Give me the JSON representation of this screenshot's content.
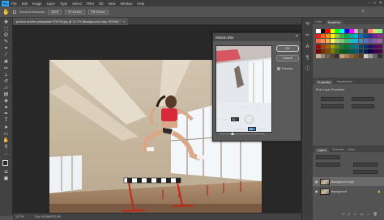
{
  "menubar": {
    "logo": "Ps",
    "items": [
      "File",
      "Edit",
      "Image",
      "Layer",
      "Type",
      "Select",
      "Filter",
      "3D",
      "View",
      "Window",
      "Help"
    ]
  },
  "options_bar": {
    "scroll_all_windows": "Scroll All Windows",
    "zoom_value": "100%",
    "fit_screen": "Fit Screen",
    "fill_screen": "Fill Screen"
  },
  "document_tab": {
    "title": "powers andres pierquidde 578734.jpg @ 12.7% (Background copy, RGB/8) *",
    "close": "×"
  },
  "status_bar": {
    "zoom": "12.7%",
    "doc_info": "Doc: 62.6M/125.2M"
  },
  "dialog": {
    "title": "Motion Blur",
    "ok_label": "OK",
    "cancel_label": "Cancel",
    "preview_label": "Preview",
    "preview_checked": true,
    "zoom_percent": "100%",
    "angle_label": "Angle:",
    "angle_value": "11",
    "angle_unit": "°",
    "distance_label": "Distance:",
    "distance_value": "45",
    "distance_unit": "Pixels"
  },
  "swatches_panel": {
    "tabs": [
      "Color",
      "Swatches"
    ],
    "active_tab": "Swatches",
    "colors": [
      "#ffffff",
      "#000000",
      "#ff0000",
      "#ffff00",
      "#00ff00",
      "#00ffff",
      "#0000ff",
      "#ff00ff",
      "#bfbfbf",
      "#808080",
      "#404040",
      "#ff8080",
      "#ffd080",
      "#80ff80",
      "#ed1c24",
      "#f26522",
      "#f7941d",
      "#fff200",
      "#8dc63f",
      "#39b54a",
      "#00a651",
      "#00a99d",
      "#00aeef",
      "#0072bc",
      "#0054a6",
      "#2e3192",
      "#662d91",
      "#92278f",
      "#f26c4f",
      "#f68e56",
      "#fbaf5d",
      "#fff568",
      "#acd373",
      "#7cc576",
      "#3cb878",
      "#1cbbb4",
      "#00bff3",
      "#448ccb",
      "#5574b9",
      "#605ca8",
      "#8560a8",
      "#a763a8",
      "#9e0b0f",
      "#a0410d",
      "#a36209",
      "#aba000",
      "#598527",
      "#197b30",
      "#007236",
      "#00746b",
      "#0076a3",
      "#004a80",
      "#003471",
      "#1b1464",
      "#440e62",
      "#630460",
      "#790000",
      "#7b2e00",
      "#7d4900",
      "#827b00",
      "#406618",
      "#005e20",
      "#005826",
      "#005952",
      "#005b7f",
      "#003663",
      "#002157",
      "#0d004c",
      "#32004b",
      "#4b0049",
      "#c7b299",
      "#998675",
      "#736357",
      "#534741",
      "#37302d",
      "#c69c6d",
      "#a67c52",
      "#8c6239",
      "#754c24",
      "#603913",
      "#cccccc",
      "#999999",
      "#666666",
      "#333333"
    ]
  },
  "properties_panel": {
    "tabs": [
      "Properties",
      "Adjustments"
    ],
    "active_tab": "Properties",
    "subtitle": "Pixel Layer Properties"
  },
  "layers_panel": {
    "tabs": [
      "Layers",
      "Channels",
      "Paths"
    ],
    "active_tab": "Layers",
    "layers": [
      {
        "name": "Background copy",
        "selected": true
      },
      {
        "name": "Background",
        "selected": false
      }
    ]
  }
}
